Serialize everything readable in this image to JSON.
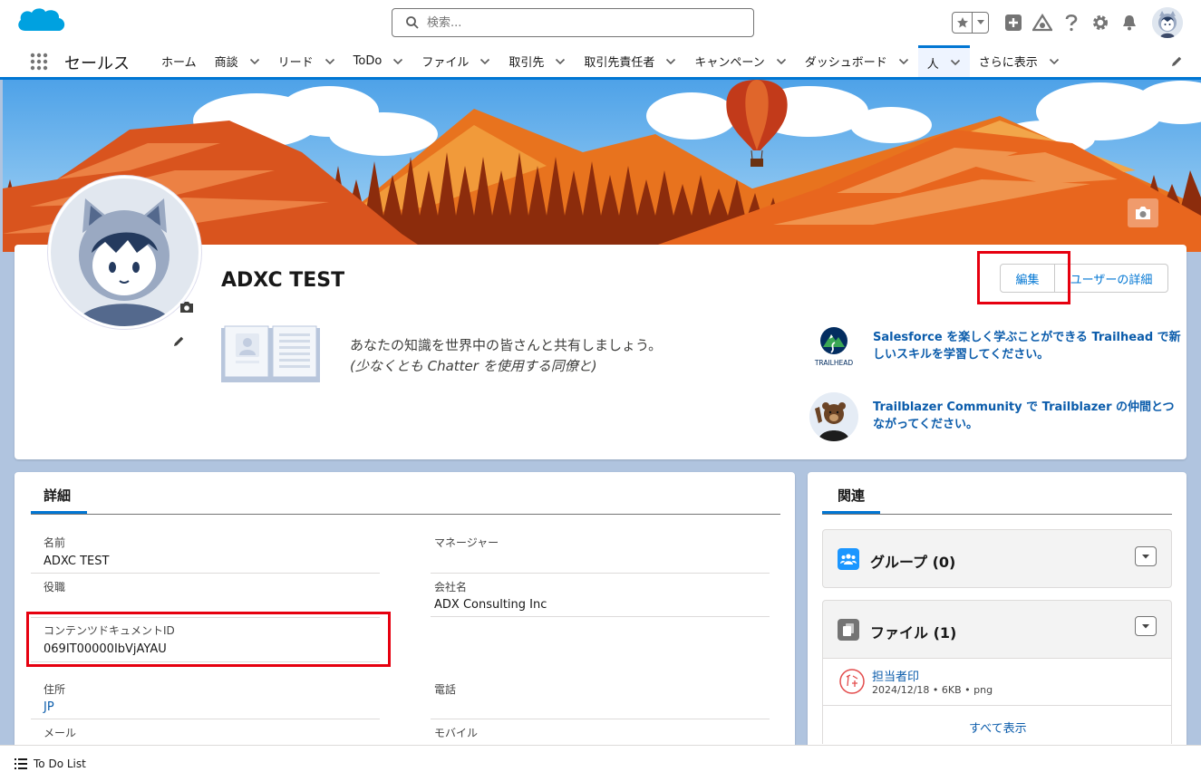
{
  "colors": {
    "brand": "#0176d3",
    "link": "#0b5cab",
    "highlight": "#e6000f"
  },
  "header": {
    "logo_name": "salesforce-cloud",
    "search_placeholder": "検索..."
  },
  "nav": {
    "app_name": "セールス",
    "items": [
      {
        "label": "ホーム",
        "dropdown": false
      },
      {
        "label": "商談",
        "dropdown": true
      },
      {
        "label": "リード",
        "dropdown": true
      },
      {
        "label": "ToDo",
        "dropdown": true
      },
      {
        "label": "ファイル",
        "dropdown": true
      },
      {
        "label": "取引先",
        "dropdown": true
      },
      {
        "label": "取引先責任者",
        "dropdown": true
      },
      {
        "label": "キャンペーン",
        "dropdown": true
      },
      {
        "label": "ダッシュボード",
        "dropdown": true
      },
      {
        "label": "人",
        "dropdown": true,
        "active": true
      },
      {
        "label": "さらに表示",
        "dropdown": true
      }
    ]
  },
  "profile": {
    "name": "ADXC TEST",
    "edit_label": "編集",
    "user_detail_label": "ユーザーの詳細",
    "share_line1": "あなたの知識を世界中の皆さんと共有しましょう。",
    "share_line2": "(少なくとも Chatter を使用する同僚と)",
    "trailhead_logo_text": "TRAILHEAD",
    "trailhead_link": "Salesforce を楽しく学ぶことができる Trailhead で新しいスキルを学習してください。",
    "community_link": "Trailblazer Community で Trailblazer の仲間とつながってください。"
  },
  "details": {
    "tab_label": "詳細",
    "fields": {
      "name_label": "名前",
      "name_value": "ADXC TEST",
      "manager_label": "マネージャー",
      "title_label": "役職",
      "company_label": "会社名",
      "company_value": "ADX Consulting Inc",
      "content_doc_label": "コンテンツドキュメントID",
      "content_doc_value": "069IT00000IbVjAYAU",
      "address_label": "住所",
      "address_value": "JP",
      "phone_label": "電話",
      "email_label": "メール",
      "mobile_label": "モバイル"
    }
  },
  "related": {
    "tab_label": "関連",
    "groups_title": "グループ (0)",
    "files_title": "ファイル (1)",
    "file": {
      "name": "担当者印",
      "meta": "2024/12/18 • 6KB • png"
    },
    "view_all": "すべて表示"
  },
  "footer": {
    "label": "To Do List"
  }
}
